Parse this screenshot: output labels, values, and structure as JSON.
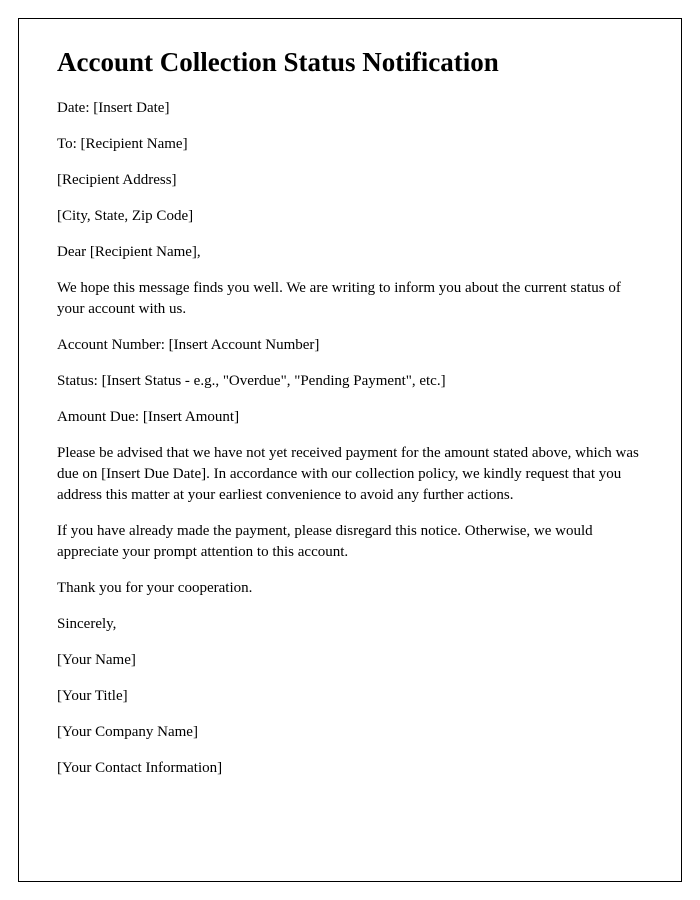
{
  "title": "Account Collection Status Notification",
  "lines": {
    "date": "Date: [Insert Date]",
    "to": "To: [Recipient Name]",
    "address": "[Recipient Address]",
    "cityStateZip": "[City, State, Zip Code]",
    "salutation": "Dear [Recipient Name],",
    "intro": "We hope this message finds you well. We are writing to inform you about the current status of your account with us.",
    "accountNumber": "Account Number: [Insert Account Number]",
    "status": "Status: [Insert Status - e.g., \"Overdue\", \"Pending Payment\", etc.]",
    "amountDue": "Amount Due: [Insert Amount]",
    "body1": "Please be advised that we have not yet received payment for the amount stated above, which was due on [Insert Due Date]. In accordance with our collection policy, we kindly request that you address this matter at your earliest convenience to avoid any further actions.",
    "body2": "If you have already made the payment, please disregard this notice. Otherwise, we would appreciate your prompt attention to this account.",
    "thanks": "Thank you for your cooperation.",
    "closing": "Sincerely,",
    "senderName": "[Your Name]",
    "senderTitle": "[Your Title]",
    "senderCompany": "[Your Company Name]",
    "senderContact": "[Your Contact Information]"
  }
}
